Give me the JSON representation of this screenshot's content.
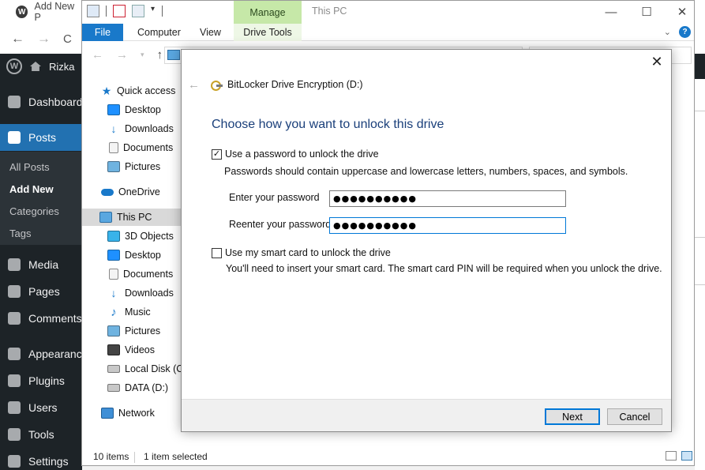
{
  "browser": {
    "tab_title": "Add New P",
    "nav": {
      "back": "←",
      "forward": "→",
      "reload": "C"
    }
  },
  "wp": {
    "site_name": "Rizka",
    "menu": [
      {
        "label": "Dashboard",
        "icon": "dashboard-icon"
      },
      {
        "label": "Posts",
        "icon": "pin-icon"
      },
      {
        "label": "Media",
        "icon": "media-icon"
      },
      {
        "label": "Pages",
        "icon": "pages-icon"
      },
      {
        "label": "Comments",
        "icon": "comments-icon"
      },
      {
        "label": "Appearance",
        "icon": "appearance-icon"
      },
      {
        "label": "Plugins",
        "icon": "plugins-icon"
      },
      {
        "label": "Users",
        "icon": "users-icon"
      },
      {
        "label": "Tools",
        "icon": "tools-icon"
      },
      {
        "label": "Settings",
        "icon": "settings-icon"
      }
    ],
    "posts_sub": [
      "All Posts",
      "Add New",
      "Categories",
      "Tags"
    ]
  },
  "explorer": {
    "title": "This PC",
    "contextual_tab": "Manage",
    "ribbon_tabs": [
      "File",
      "Computer",
      "View",
      "Drive Tools"
    ],
    "window_controls": {
      "minimize": "—",
      "maximize": "☐",
      "close": "✕"
    },
    "ribbon_expand": "⌄",
    "help": "?",
    "nav_pane": [
      {
        "label": "Quick access",
        "icon": "star"
      },
      {
        "label": "Desktop",
        "icon": "desktop"
      },
      {
        "label": "Downloads",
        "icon": "down"
      },
      {
        "label": "Documents",
        "icon": "doc"
      },
      {
        "label": "Pictures",
        "icon": "pic"
      },
      {
        "label": "OneDrive",
        "icon": "cloud"
      },
      {
        "label": "This PC",
        "icon": "pc"
      },
      {
        "label": "3D Objects",
        "icon": "3d"
      },
      {
        "label": "Desktop",
        "icon": "desktop"
      },
      {
        "label": "Documents",
        "icon": "doc"
      },
      {
        "label": "Downloads",
        "icon": "down"
      },
      {
        "label": "Music",
        "icon": "music"
      },
      {
        "label": "Pictures",
        "icon": "pic"
      },
      {
        "label": "Videos",
        "icon": "video"
      },
      {
        "label": "Local Disk (C:)",
        "icon": "disk"
      },
      {
        "label": "DATA (D:)",
        "icon": "disk"
      },
      {
        "label": "Network",
        "icon": "net"
      }
    ],
    "status": {
      "item_count": "10 items",
      "selected": "1 item selected"
    }
  },
  "dialog": {
    "close": "✕",
    "back": "←",
    "window_title": "BitLocker Drive Encryption (D:)",
    "heading": "Choose how you want to unlock this drive",
    "password_option": {
      "label": "Use a password to unlock the drive",
      "checked": true,
      "description": "Passwords should contain uppercase and lowercase letters, numbers, spaces, and symbols."
    },
    "enter_password": {
      "label": "Enter your password",
      "value": "●●●●●●●●●●"
    },
    "reenter_password": {
      "label": "Reenter your password",
      "value": "●●●●●●●●●●"
    },
    "smartcard_option": {
      "label": "Use my smart card to unlock the drive",
      "checked": false,
      "description": "You'll need to insert your smart card. The smart card PIN will be required when you unlock the drive."
    },
    "buttons": {
      "next": "Next",
      "cancel": "Cancel"
    }
  },
  "colors": {
    "accent": "#0078d7",
    "wp_sidebar": "#1d2327",
    "wp_active": "#2271b1",
    "manage_tab": "#c6e8a8",
    "heading": "#1a3f7a",
    "file_tab": "#1979ca"
  }
}
